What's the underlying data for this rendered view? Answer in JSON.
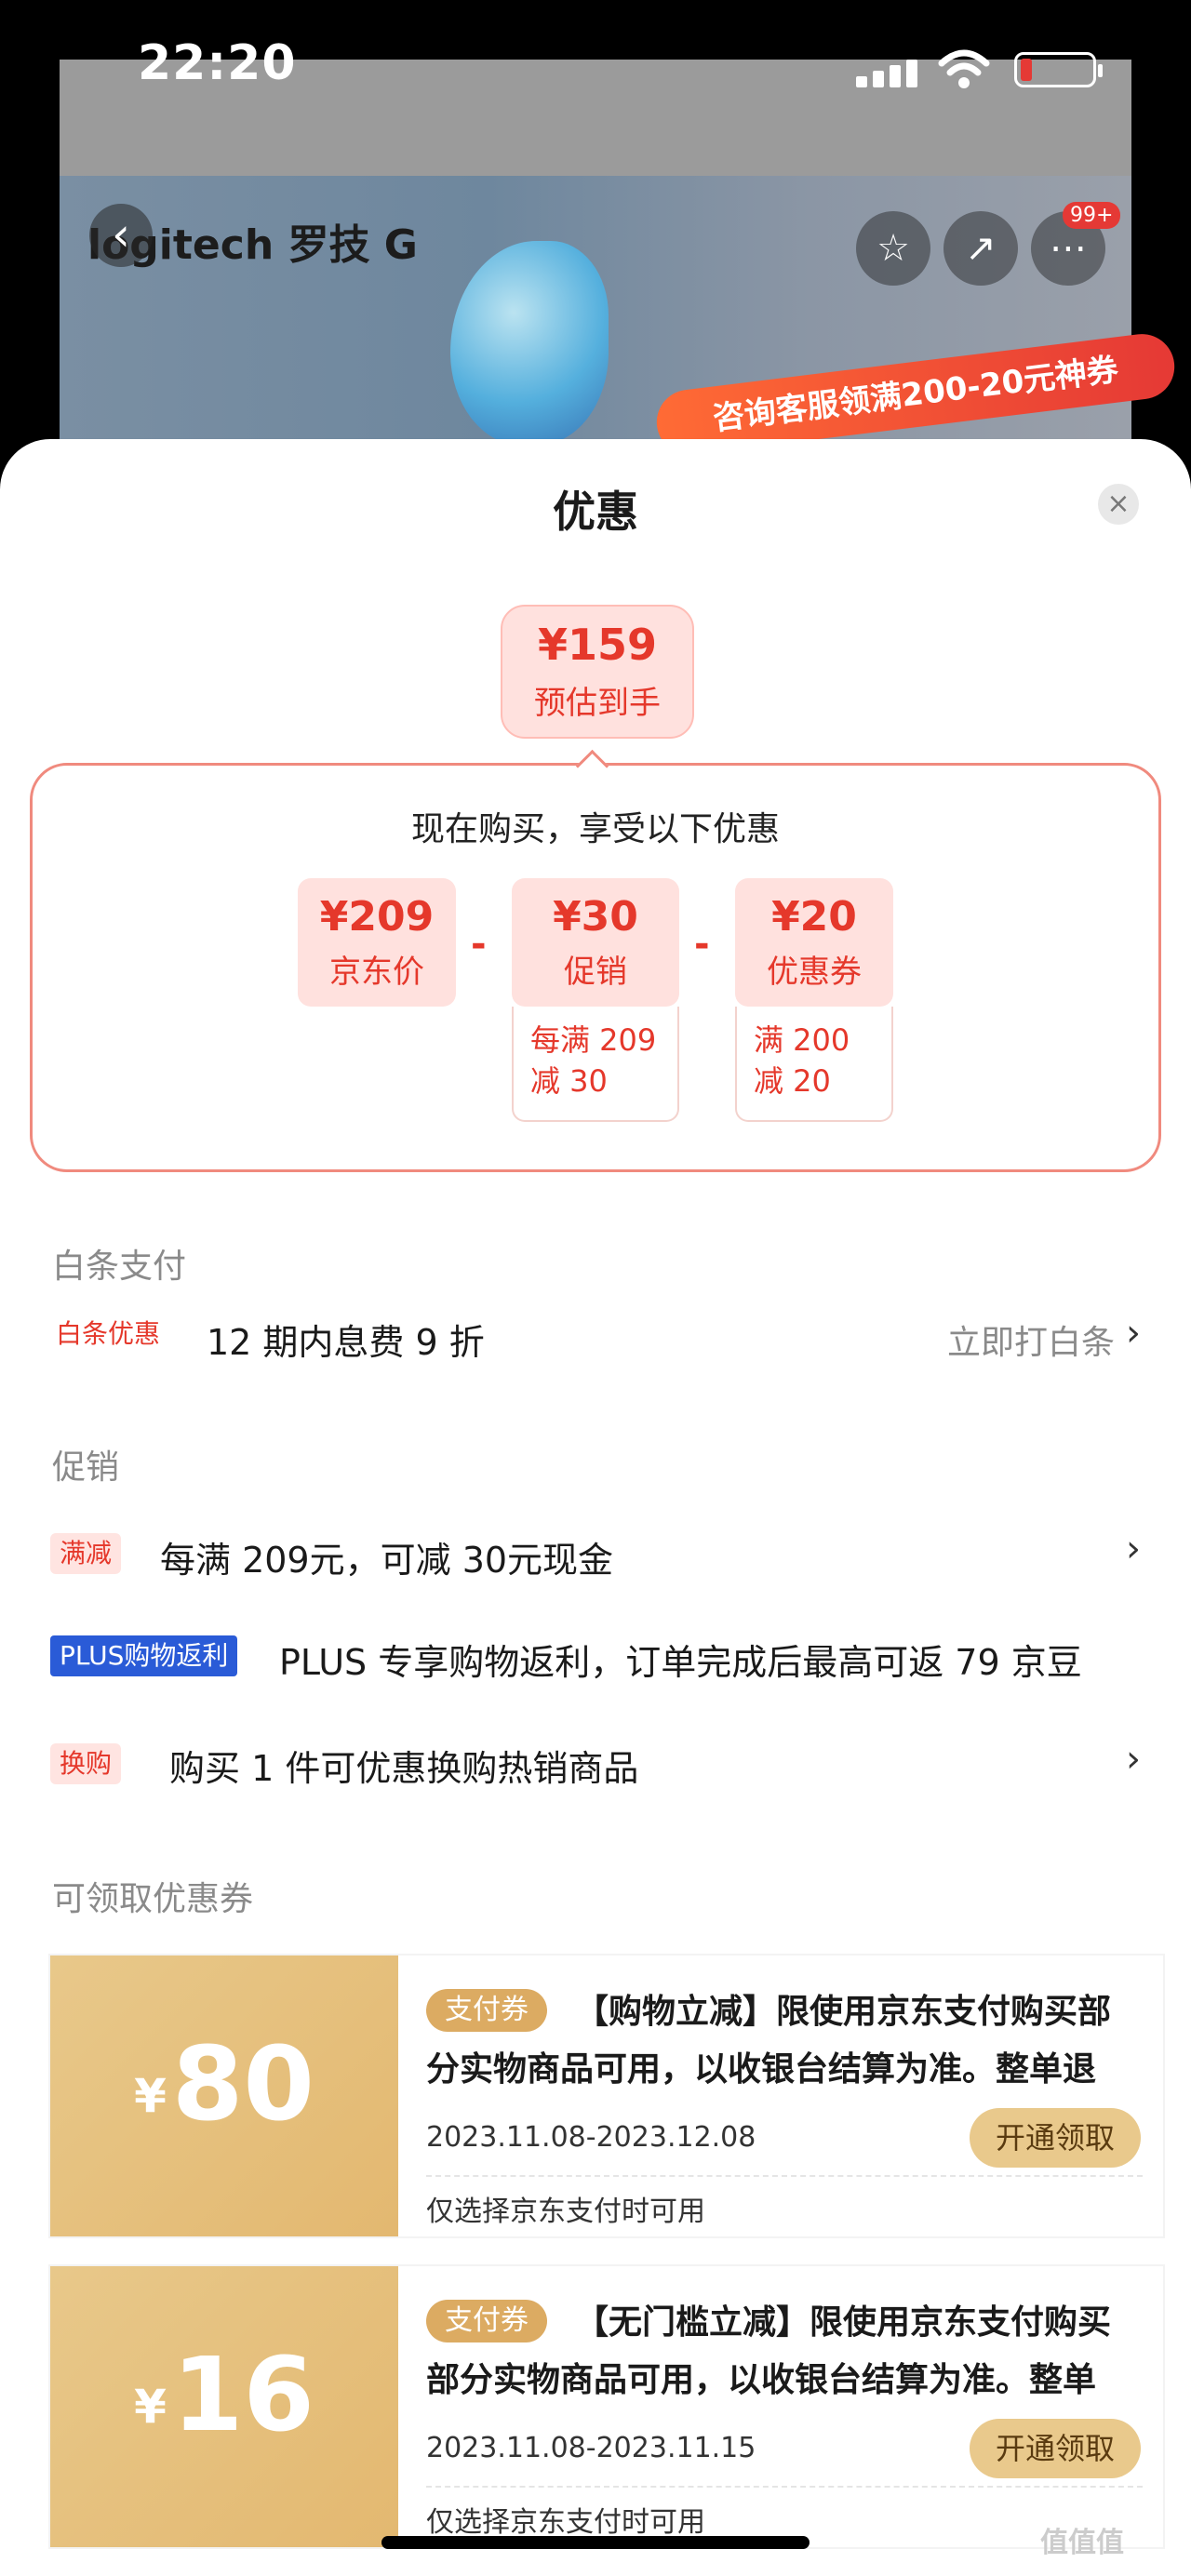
{
  "status": {
    "time": "22:20"
  },
  "background": {
    "brand": "logitech 罗技 G",
    "badge": "99+",
    "promo": "咨询客服领满200-20元神券"
  },
  "sheet": {
    "title": "优惠",
    "estimate": {
      "price": "¥159",
      "label": "预估到手"
    },
    "breakdown": {
      "title": "现在购买，享受以下优惠",
      "items": [
        {
          "value": "¥209",
          "label": "京东价"
        },
        {
          "value": "¥30",
          "label": "促销",
          "detail": "每满 209 减 30"
        },
        {
          "value": "¥20",
          "label": "优惠券",
          "detail": "满 200 减 20"
        }
      ],
      "minus": "-"
    },
    "baitiao": {
      "heading": "白条支付",
      "tag": "白条优惠",
      "text": "12 期内息费 9 折",
      "link": "立即打白条",
      "chevron": "›"
    },
    "promotions": {
      "heading": "促销",
      "items": [
        {
          "tag": "满减",
          "text": "每满 209元，可减 30元现金",
          "chevron": "›"
        },
        {
          "tag": "PLUS购物返利",
          "text": "PLUS 专享购物返利，订单完成后最高可返 79 京豆"
        },
        {
          "tag": "换购",
          "text": "购买 1 件可优惠换购热销商品",
          "chevron": "›"
        }
      ]
    },
    "coupons": {
      "heading": "可领取优惠券",
      "items": [
        {
          "currency": "¥",
          "amount": "80",
          "tag": "支付券",
          "desc": "【购物立减】限使用京东支付购买部分实物商品可用，以收银台结算为准。整单退款…",
          "date": "2023.11.08-2023.12.08",
          "button": "开通领取",
          "note": "仅选择京东支付时可用"
        },
        {
          "currency": "¥",
          "amount": "16",
          "tag": "支付券",
          "desc": "【无门槛立减】限使用京东支付购买部分实物商品可用，以收银台结算为准。整单退…",
          "date": "2023.11.08-2023.11.15",
          "button": "开通领取",
          "note": "仅选择京东支付时可用"
        }
      ]
    }
  },
  "watermark": "值值值",
  "colors": {
    "accent": "#e5382b",
    "gold": "#e3b870",
    "plus": "#2a5bd7"
  }
}
